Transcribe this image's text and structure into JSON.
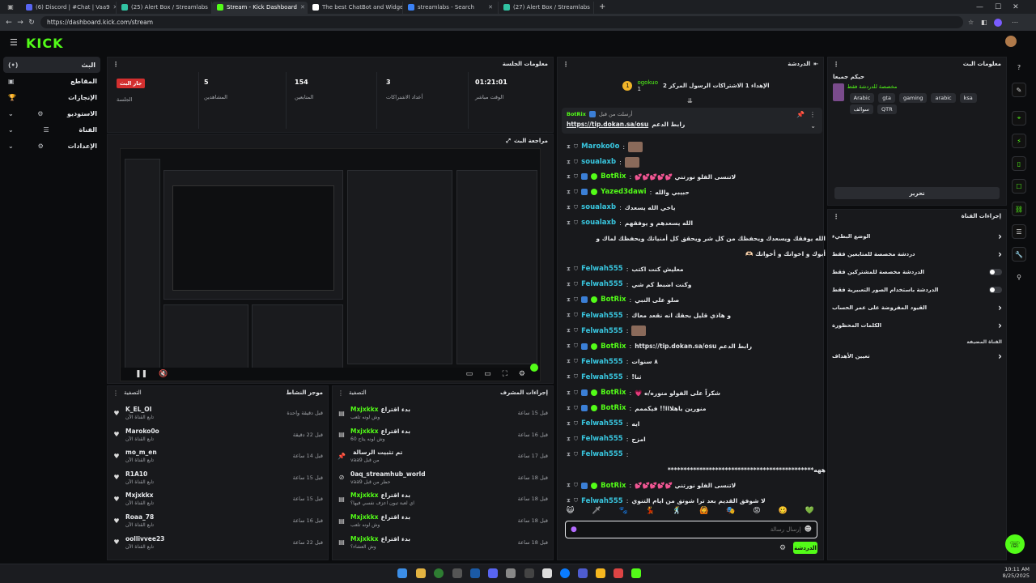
{
  "browser": {
    "tabs": [
      {
        "title": "(6) Discord | #Chat | Vaa9",
        "color": "#5865f2"
      },
      {
        "title": "(25) Alert Box / Streamlabs",
        "color": "#31c3a2"
      },
      {
        "title": "Stream - Kick Dashboard",
        "color": "#53fc18",
        "active": true
      },
      {
        "title": "The best ChatBot and Widgets for",
        "color": "#ffffff"
      },
      {
        "title": "streamlabs - Search",
        "color": "#3b82f6"
      },
      {
        "title": "(27) Alert Box / Streamlabs",
        "color": "#31c3a2"
      }
    ],
    "new_tab": "+",
    "url": "https://dashboard.kick.com/stream"
  },
  "app": {
    "logo": "KICK",
    "sidebar": [
      {
        "label": "البث",
        "icon": "(•)",
        "active": true
      },
      {
        "label": "المقاطع",
        "icon": "▣"
      },
      {
        "label": "الإنجازات",
        "icon": "🏆"
      },
      {
        "label": "الاستوديو",
        "icon": "⚙",
        "expand": true
      },
      {
        "label": "القناة",
        "icon": "☰",
        "expand": true
      },
      {
        "label": "الإعدادات",
        "icon": "⚙",
        "expand": true
      }
    ]
  },
  "session": {
    "title": "معلومات الجلسة",
    "stats": [
      {
        "value": "01:21:01",
        "label": "الوقت مباشر"
      },
      {
        "value": "3",
        "label": "أعداد الاشتراكات"
      },
      {
        "value": "154",
        "label": "المتابعين"
      },
      {
        "value": "5",
        "label": "المشاهدين"
      },
      {
        "value": "جار البث",
        "label": "الجلسة",
        "badge": true
      }
    ]
  },
  "preview": {
    "title": "مراجعة البث"
  },
  "activity": {
    "title": "موجز النشاط",
    "filter": "التصفية",
    "items": [
      {
        "name": "K_EL_OI",
        "sub": "تابع القناة الآن",
        "time": "قبل دقيقة واحدة"
      },
      {
        "name": "Maroko0o",
        "sub": "تابع القناة الآن",
        "time": "قبل 22 دقيقة"
      },
      {
        "name": "mo_m_en",
        "sub": "تابع القناة الآن",
        "time": "قبل 14 ساعة"
      },
      {
        "name": "R1A10",
        "sub": "تابع القناة الآن",
        "time": "قبل 15 ساعة"
      },
      {
        "name": "Mxjxkkx",
        "sub": "تابع القناة الآن",
        "time": "قبل 15 ساعة"
      },
      {
        "name": "Roaa_78",
        "sub": "تابع القناة الآن",
        "time": "قبل 16 ساعة"
      },
      {
        "name": "oollivvee23",
        "sub": "تابع القناة الآن",
        "time": "قبل 22 ساعة"
      }
    ]
  },
  "mod": {
    "title": "إجراءات المشرف",
    "filter": "التصفية",
    "items": [
      {
        "name": "Mxjxkkx",
        "pre": "بدء اقتراع",
        "sub": "وش لونه تلعب",
        "time": "قبل 15 ساعة",
        "icon": "▤"
      },
      {
        "name": "Mxjxkkx",
        "pre": "بدء اقتراع",
        "sub": "وش لونه يتاح 60",
        "time": "قبل 16 ساعة",
        "icon": "▤"
      },
      {
        "name": "",
        "pre": "تم تثبيت الرسالة",
        "sub": "vaa9 من قبل",
        "time": "قبل 17 ساعة",
        "icon": "📌"
      },
      {
        "name": "0aq_streamhub_world",
        "pre": "",
        "sub": "vaa9 حظر من قبل",
        "time": "قبل 18 ساعة",
        "icon": "⊘"
      },
      {
        "name": "Mxjxkkx",
        "pre": "بدء اقتراع",
        "sub": "اي لعبة تبون اعزف نفسي فيها؟",
        "time": "قبل 18 ساعة",
        "icon": "▤"
      },
      {
        "name": "Mxjxkkx",
        "pre": "بدء اقتراع",
        "sub": "وش لونه تلعب",
        "time": "قبل 18 ساعة",
        "icon": "▤"
      },
      {
        "name": "Mxjxkkx",
        "pre": "بدء اقتراع",
        "sub": "وش العشاء؟",
        "time": "قبل 18 ساعة",
        "icon": "▤"
      }
    ]
  },
  "chat": {
    "title": "الدردشة",
    "top_user": "ogokuo",
    "top_count": "1",
    "top_text": "الإهداء 1 الاشتراكات الرسول المركز 2",
    "pinned_by": "أرسلت من قبل",
    "pinned_user": "BotRix",
    "pinned_text": "رابط الدعم",
    "pinned_link": "https://tip.dokan.sa/osu",
    "messages": [
      {
        "user": "Maroko0o",
        "color": "blue",
        "text": "",
        "thumb": true
      },
      {
        "user": "soualaxb",
        "color": "blue",
        "text": "",
        "thumb": true
      },
      {
        "user": "BotRix",
        "color": "green",
        "text": "لاتنسى الفلو نورتني 💕💕💕💕💕"
      },
      {
        "user": "Yazed3dawi",
        "color": "green",
        "text": "حبيبي والله"
      },
      {
        "user": "soualaxb",
        "color": "blue",
        "text": "ياخي الله يسعدك"
      },
      {
        "user": "soualaxb",
        "color": "blue",
        "text": "الله يسعدهم و يوفقهم"
      },
      {
        "user": "",
        "color": "blue",
        "text": "الله يوفقك ويسعدك ويحفظك من كل شر ويحقق كل أمنياتك ويحفظك لماك و"
      },
      {
        "user": "",
        "color": "blue",
        "text": "أبوك و اخوانك و أخواتك 🫶🏻"
      },
      {
        "user": "Felwah555",
        "color": "blue",
        "text": "معليش كنت اكتب"
      },
      {
        "user": "Felwah555",
        "color": "blue",
        "text": "وكنت اضبط كم شي"
      },
      {
        "user": "BotRix",
        "color": "green",
        "text": "صلو على النبي"
      },
      {
        "user": "Felwah555",
        "color": "blue",
        "text": "و هاذي قليل بحقك انه نقعد معاك"
      },
      {
        "user": "Felwah555",
        "color": "blue",
        "text": "",
        "thumb": true
      },
      {
        "user": "BotRix",
        "color": "green",
        "text": "رابط الدعم https://tip.dokan.sa/osu"
      },
      {
        "user": "Felwah555",
        "color": "blue",
        "text": "٨ سنوات"
      },
      {
        "user": "Felwah555",
        "color": "blue",
        "text": "ثنا!"
      },
      {
        "user": "BotRix",
        "color": "green",
        "text": "شكراً على الفولو منوره/ه 💗"
      },
      {
        "user": "BotRix",
        "color": "green",
        "text": "منورين ياهلااا!! فيكممم"
      },
      {
        "user": "Felwah555",
        "color": "blue",
        "text": "ايه"
      },
      {
        "user": "Felwah555",
        "color": "blue",
        "text": "امزح"
      },
      {
        "user": "Felwah555",
        "color": "blue",
        "text": ""
      },
      {
        "user": "",
        "color": "blue",
        "text": "ههه**********************************************"
      },
      {
        "user": "BotRix",
        "color": "green",
        "text": "لاتنسى الفلو نورتني 💕💕💕💕💕"
      },
      {
        "user": "Felwah555",
        "color": "blue",
        "text": "لا شوفق القديم بعد ترا شوتق من ايام التنوي"
      }
    ],
    "input_placeholder": "إرسال رسالة",
    "send": "الدردشة"
  },
  "stream_info": {
    "title": "معلومات البث",
    "stream_title": "حيكم جميعا",
    "category": "مخصصة للدردشة فقط",
    "tags": [
      "Arabic",
      "gta",
      "gaming",
      "arabic",
      "ksa",
      "سوالف",
      "QTR"
    ],
    "edit": "تحرير"
  },
  "channel_actions": {
    "title": "إجراءات القناة",
    "items": [
      {
        "label": "الوضع البطيء",
        "type": "arrow"
      },
      {
        "label": "دردشة مخصصة للمتابعين فقط",
        "type": "arrow"
      },
      {
        "label": "الدردشة مخصصة للمشتركين فقط",
        "type": "toggle"
      },
      {
        "label": "الدردشة باستخدام الصور التعبيرية فقط",
        "type": "toggle"
      },
      {
        "label": "القيود المفروضة على عمر الحساب",
        "type": "arrow"
      },
      {
        "label": "الكلمات المحظورة",
        "type": "arrow"
      },
      {
        "label": "القناة المضيفة",
        "type": "none"
      },
      {
        "label": "تعيين الأهداف",
        "type": "arrow"
      }
    ]
  },
  "taskbar": {
    "time": "10:11 AM",
    "date": "8/25/2025"
  }
}
